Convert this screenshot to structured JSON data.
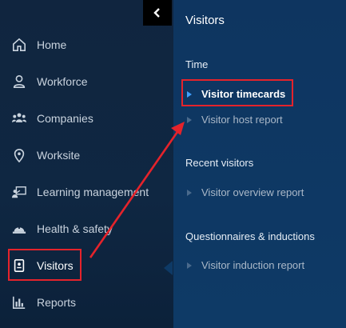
{
  "sidebar": {
    "items": [
      {
        "label": "Home",
        "icon": "home-icon"
      },
      {
        "label": "Workforce",
        "icon": "person-icon"
      },
      {
        "label": "Companies",
        "icon": "group-icon"
      },
      {
        "label": "Worksite",
        "icon": "location-pin-icon"
      },
      {
        "label": "Learning management",
        "icon": "training-icon"
      },
      {
        "label": "Health & safety",
        "icon": "hard-hat-icon"
      },
      {
        "label": "Visitors",
        "icon": "id-badge-icon",
        "active": true
      },
      {
        "label": "Reports",
        "icon": "bar-chart-icon"
      }
    ]
  },
  "panel": {
    "title": "Visitors",
    "sections": [
      {
        "heading": "Time",
        "links": [
          "Visitor timecards",
          "Visitor host report"
        ]
      },
      {
        "heading": "Recent visitors",
        "links": [
          "Visitor overview report"
        ]
      },
      {
        "heading": "Questionnaires & inductions",
        "links": [
          "Visitor induction report"
        ]
      }
    ]
  },
  "colors": {
    "annotation": "#e5232b",
    "sidebar_bg": "#10253f",
    "panel_bg": "#0e3a66",
    "active_caret": "#3fa0ff"
  }
}
